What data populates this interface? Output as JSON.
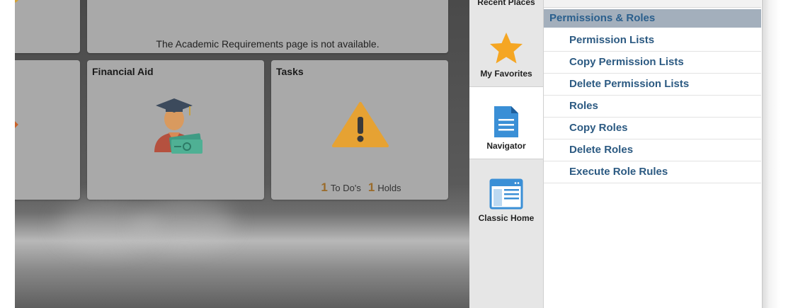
{
  "tiles": {
    "academic_requirements": {
      "message": "The Academic Requirements page is not available."
    },
    "financial_aid": {
      "title": "Financial Aid",
      "icon": "graduate-with-money-icon"
    },
    "tasks": {
      "title": "Tasks",
      "icon": "warning-icon",
      "todos_count": "1",
      "todos_label": "To Do's",
      "holds_count": "1",
      "holds_label": "Holds"
    }
  },
  "nav": {
    "items": [
      {
        "label": "Recent Places",
        "icon": "recent-places-icon"
      },
      {
        "label": "My Favorites",
        "icon": "star-icon"
      },
      {
        "label": "Navigator",
        "icon": "document-icon",
        "active": true
      },
      {
        "label": "Classic Home",
        "icon": "classic-home-icon"
      }
    ]
  },
  "menu": {
    "header": "Permissions & Roles",
    "items": [
      {
        "label": "Permission Lists"
      },
      {
        "label": "Copy Permission Lists"
      },
      {
        "label": "Delete Permission Lists"
      },
      {
        "label": "Roles"
      },
      {
        "label": "Copy Roles"
      },
      {
        "label": "Delete Roles"
      },
      {
        "label": "Execute Role Rules"
      }
    ]
  },
  "colors": {
    "menu_link": "#2c5a82",
    "menu_header_bg": "#a3afbc",
    "star": "#f5a623",
    "warning": "#e6a233",
    "navigator_icon": "#3a8fd6"
  }
}
